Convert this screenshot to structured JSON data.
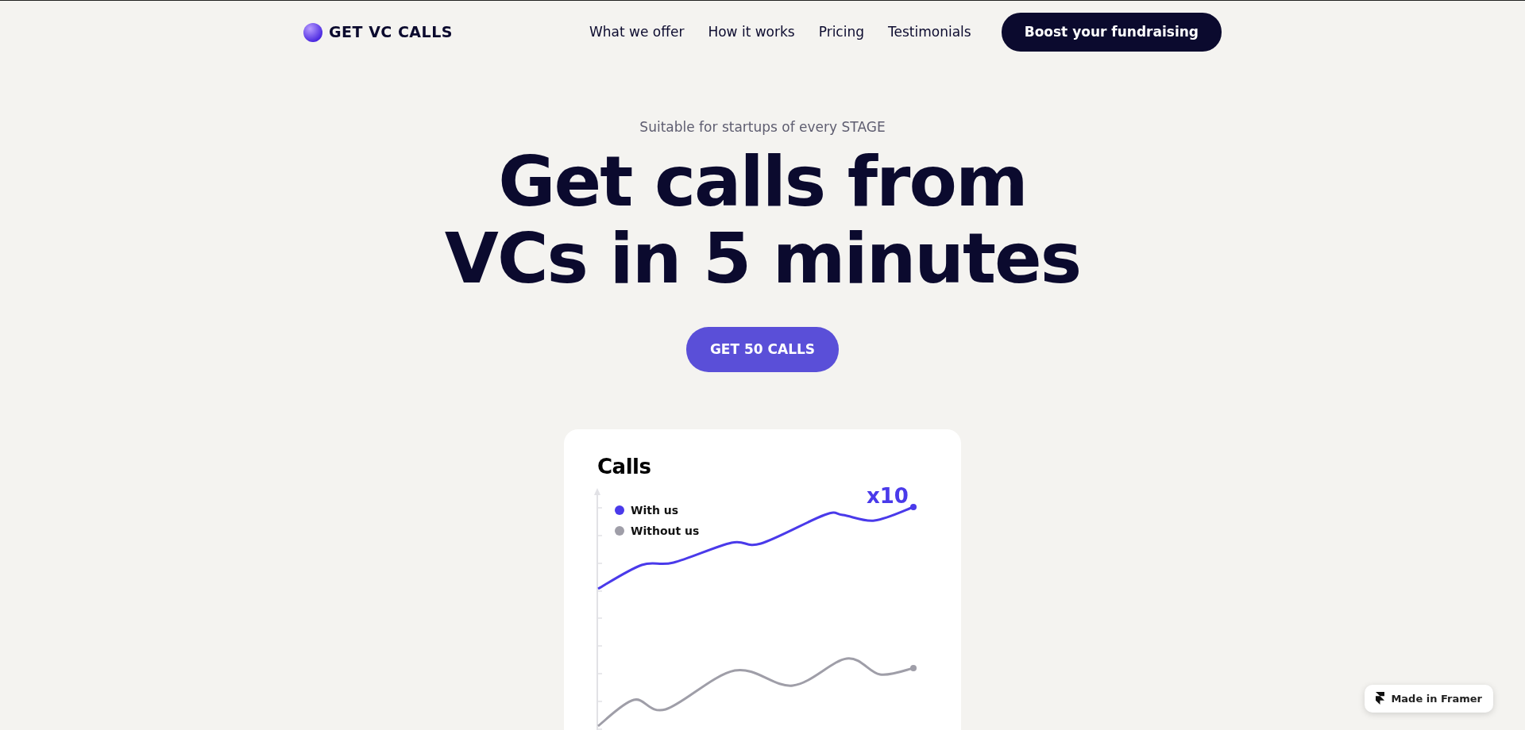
{
  "header": {
    "logo": "GET VC CALLS",
    "nav": [
      "What we offer",
      "How it works",
      "Pricing",
      "Testimonials"
    ],
    "cta": "Boost your fundraising"
  },
  "hero": {
    "tagline": "Suitable for startups of every STAGE",
    "headline": [
      "Get calls from",
      "VCs in 5 minutes"
    ],
    "button": "GET 50 CALLS"
  },
  "card": {
    "title": "Calls",
    "legend": [
      {
        "label": "With us",
        "color": "#4a3aea"
      },
      {
        "label": "Without us",
        "color": "#9f9ea8"
      }
    ],
    "annotation": "x10"
  },
  "badge": {
    "label": "Made in Framer"
  }
}
